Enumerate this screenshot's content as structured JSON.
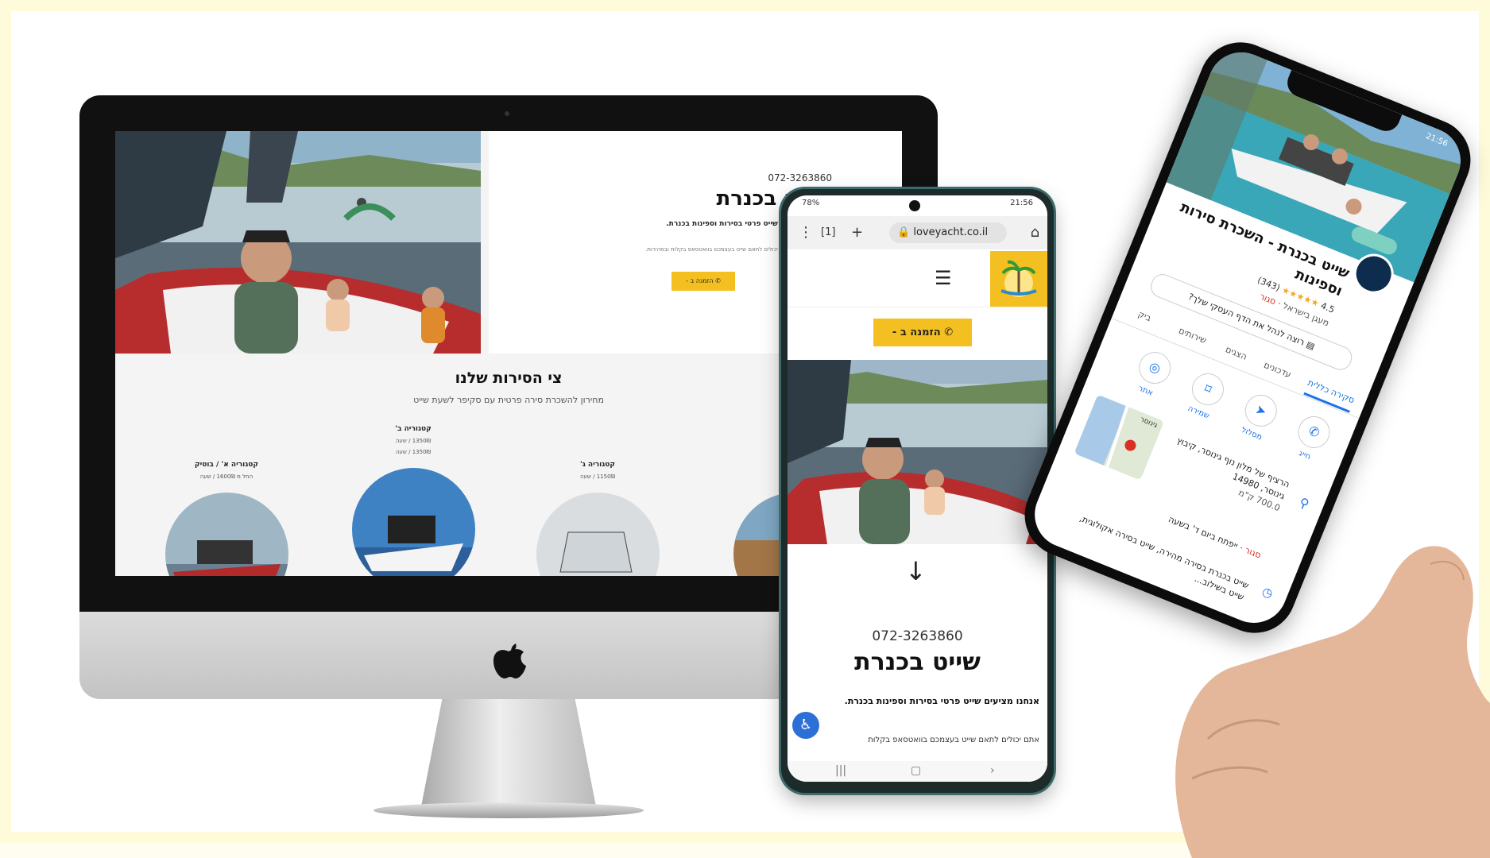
{
  "desktop": {
    "phone": "072-3263860",
    "title": "שייט בכנרת",
    "description": "אנחנו מציעים שייט פרטי בסירות וספינות בכנרת.",
    "subtext": "אתם יכולים לתאם שייט בעצמכם בוואטסאפ בקלות ובמהירות.",
    "book_button": "הזמנה ב - ",
    "fleet_title": "צי הסירות שלנו",
    "fleet_subtitle": "מחירון להשכרת סירה פרטית עם סקיפר לשעת שייט",
    "categories": [
      {
        "name": "קטגוריה א' / בוטיק",
        "price": "החל מ 1600₪ / שעה"
      },
      {
        "name": "קטגוריה ב'",
        "price": "1350₪ / שעה"
      },
      {
        "name": "קטגוריה ג'",
        "price": "1150₪ / שעה"
      }
    ]
  },
  "android": {
    "status_left": "78%",
    "status_right": "21:56",
    "url": "loveyacht.co.il",
    "tab_count": "1",
    "book_button": "הזמנה ב - ",
    "phone": "072-3263860",
    "title": "שייט בכנרת",
    "description": "אנחנו מציעים שייט פרטי בסירות וספינות בכנרת.",
    "subtext": "אתם יכולים לתאם שייט בעצמכם בוואטסאפ בקלות"
  },
  "iphone": {
    "time": "21:56",
    "title": "שייט בכנרת - השכרת סירות וספינות",
    "rating": "4.5",
    "stars": "★★★★★",
    "reviews": "(343)",
    "type": "מעגן בישראל · ",
    "closed": "סגור",
    "manage_button": "רוצה לנהל את הדף העסקי שלך?",
    "tabs": [
      "סקירה כללית",
      "עדכונים",
      "הצגים",
      "שירותים",
      "ביק"
    ],
    "actions": [
      "חייג",
      "מסלול",
      "שמירה",
      "אתר"
    ],
    "map_label": "גינוסר",
    "address": "הרציף של מלון נוף גינוסר, קיבוץ גינוסר, 14980",
    "distance": "700.0 ק\"מ",
    "hours_closed": "סגור",
    "hours_text": " · ייפתח ביום ד' בשעה",
    "about": "שייט בכנרת בסירה מהירה, שייט בסירה אקולוגית, שייט בשילוב..."
  },
  "colors": {
    "accent": "#f4c021",
    "link": "#1a73e8",
    "closed": "#d93025"
  }
}
